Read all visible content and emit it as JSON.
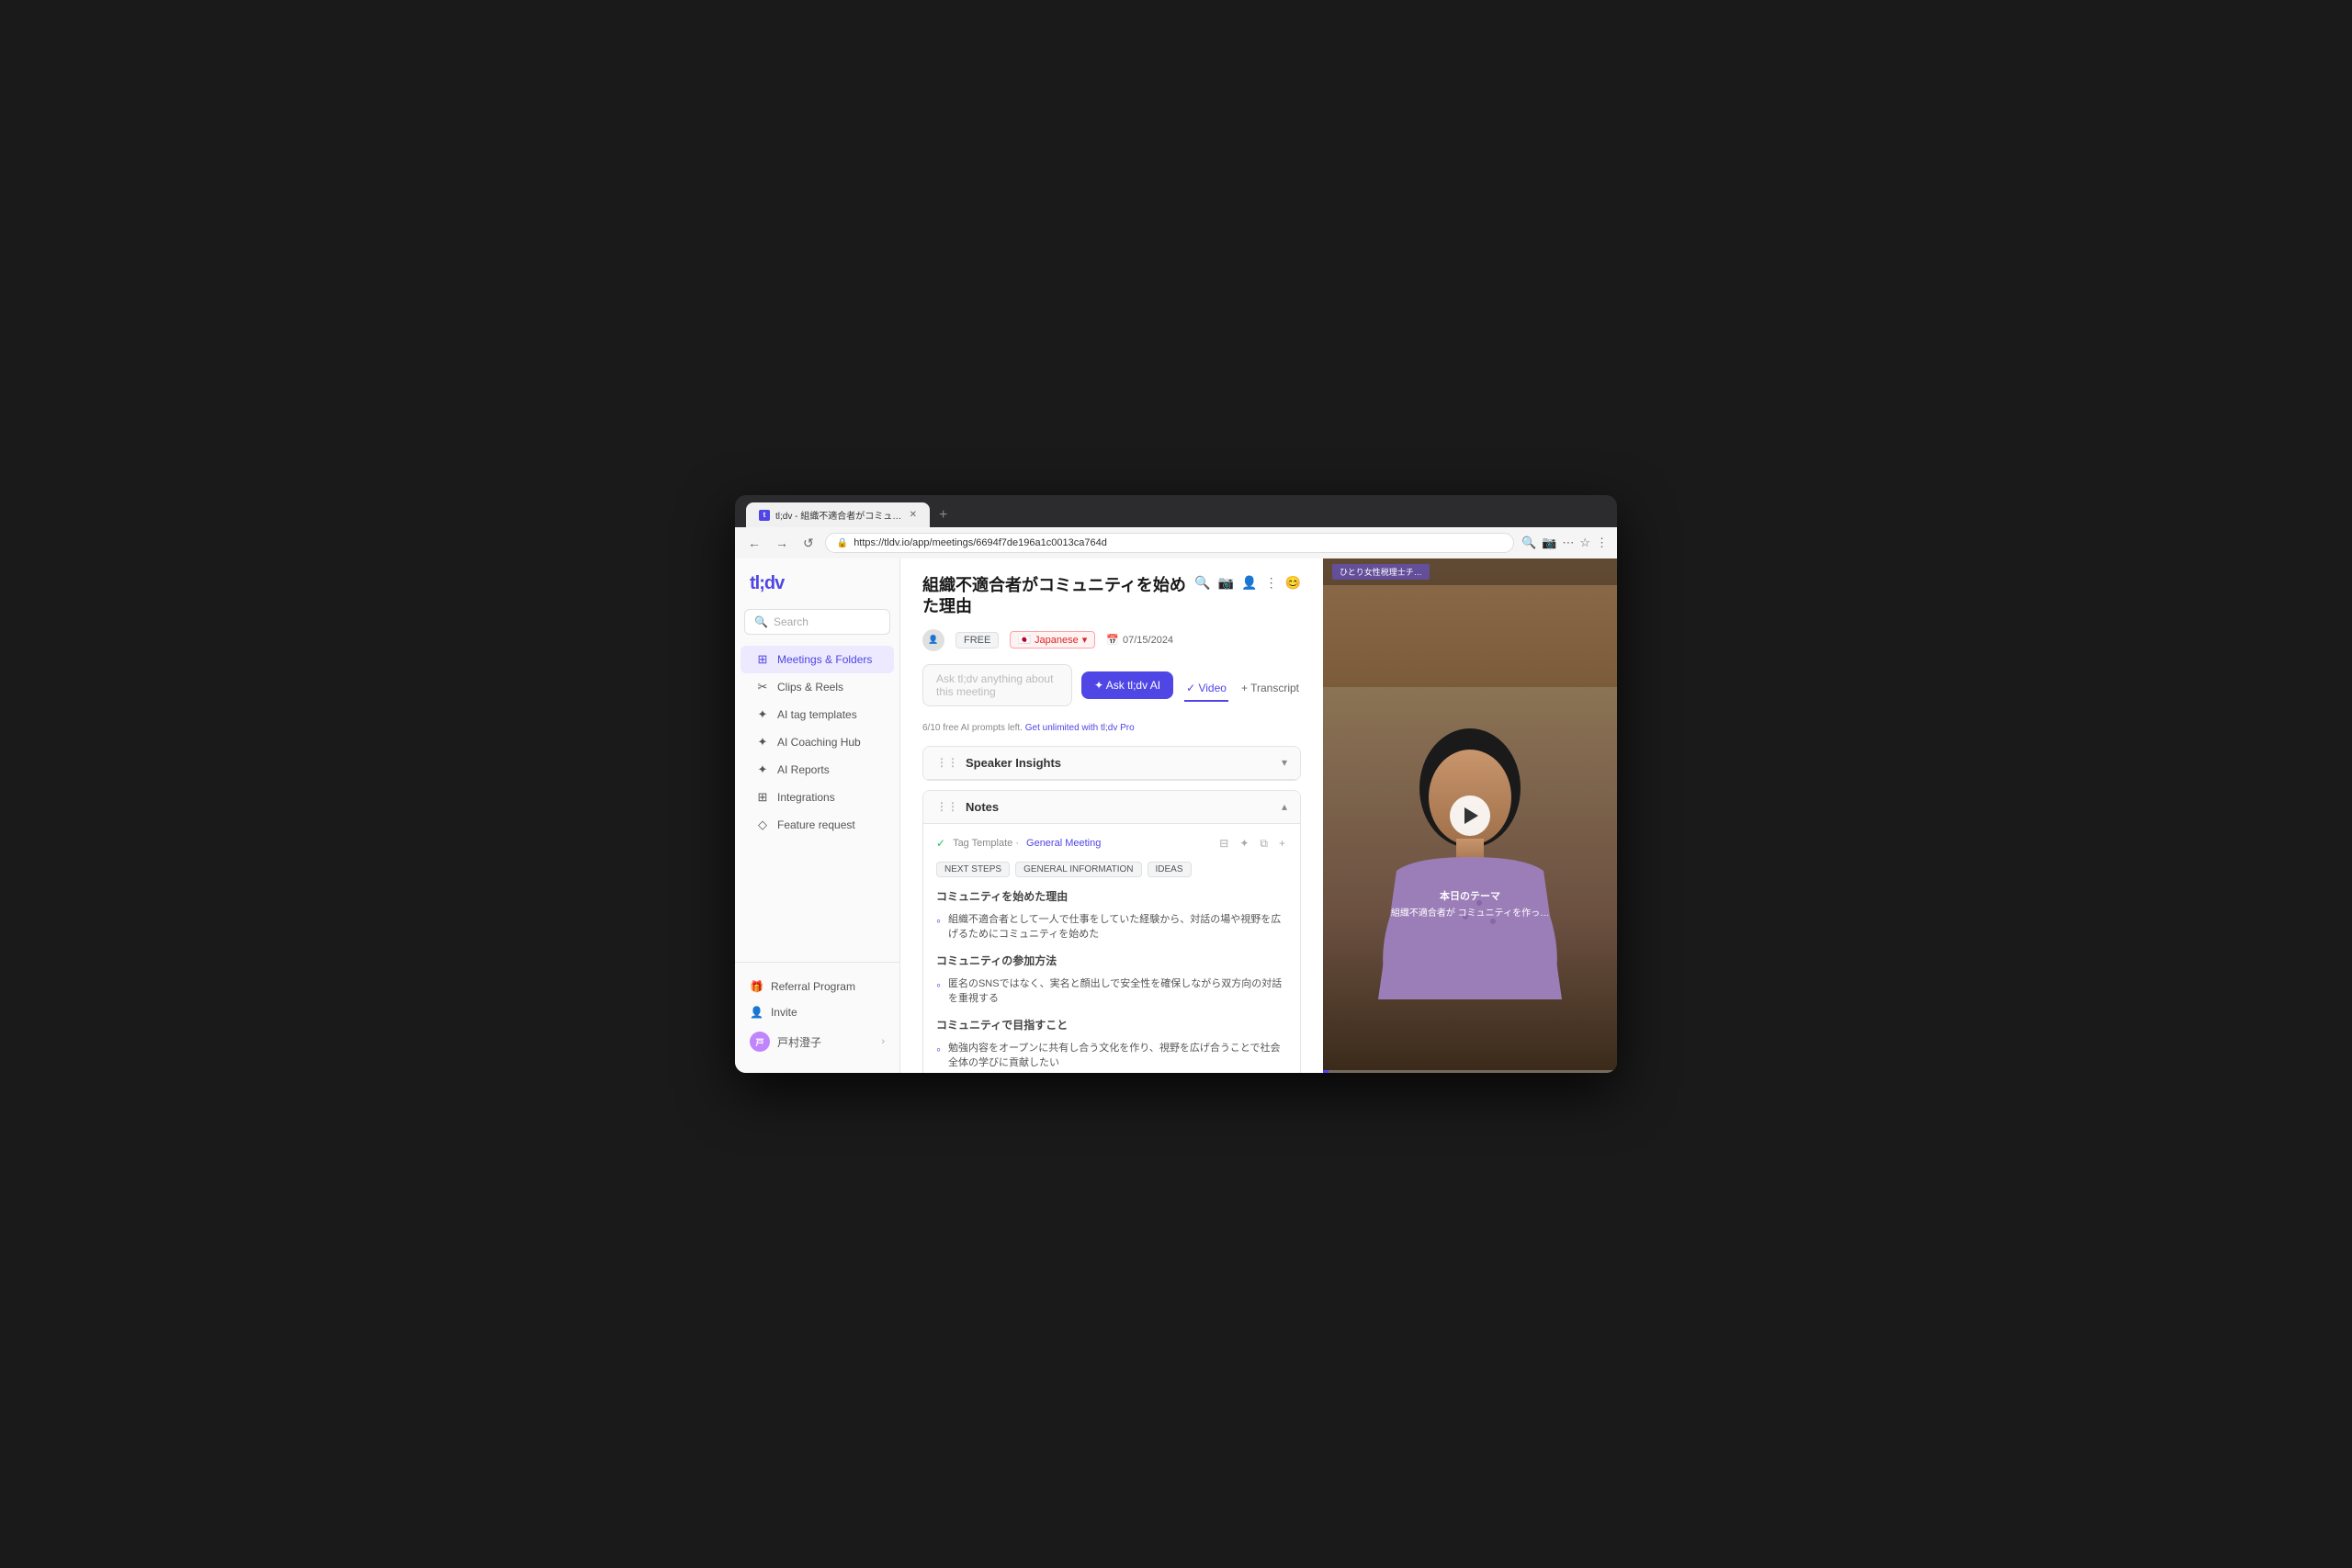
{
  "browser": {
    "tab_title": "tl;dv - 組織不適合者がコミュニ…",
    "tab_new_label": "+",
    "url": "https://tldv.io/app/meetings/6694f7de196a1c0013ca764d",
    "nav_back": "←",
    "nav_forward": "→",
    "nav_refresh": "↺"
  },
  "sidebar": {
    "logo": "tl;dv",
    "search_placeholder": "Search",
    "nav_items": [
      {
        "id": "meetings",
        "label": "Meetings & Folders",
        "icon": "⊞",
        "active": true
      },
      {
        "id": "clips",
        "label": "Clips & Reels",
        "icon": "✂"
      },
      {
        "id": "ai-tags",
        "label": "AI tag templates",
        "icon": "✦"
      },
      {
        "id": "coaching",
        "label": "AI Coaching Hub",
        "icon": "✦"
      },
      {
        "id": "reports",
        "label": "AI Reports",
        "icon": "✦"
      },
      {
        "id": "integrations",
        "label": "Integrations",
        "icon": "⊞"
      },
      {
        "id": "feature",
        "label": "Feature request",
        "icon": "◇"
      }
    ],
    "bottom_items": [
      {
        "id": "referral",
        "label": "Referral Program",
        "icon": "🎁"
      },
      {
        "id": "invite",
        "label": "Invite",
        "icon": "👤"
      }
    ],
    "user": {
      "name": "戸村澄子",
      "avatar_initials": "戸"
    }
  },
  "page": {
    "title": "組織不適合者がコミュニティを始めた理由",
    "badge_free": "FREE",
    "badge_language": "Japanese",
    "badge_date": "07/15/2024",
    "ai_input_placeholder": "Ask tl;dv anything about this meeting",
    "ask_btn_label": "✦ Ask tl;dv AI",
    "ai_hint": "6/10 free AI prompts left.",
    "ai_hint_link": "Get unlimited with tl;dv Pro",
    "view_tabs": [
      {
        "id": "video",
        "label": "✓ Video",
        "active": false
      },
      {
        "id": "transcript",
        "label": "+ Transcript",
        "active": false
      }
    ],
    "sections": [
      {
        "id": "speaker-insights",
        "title": "Speaker Insights",
        "collapsed": true
      },
      {
        "id": "notes",
        "title": "Notes",
        "collapsed": false,
        "tag_template_label": "Tag Template ·",
        "tag_template_name": "General Meeting",
        "chips": [
          "NEXT STEPS",
          "GENERAL INFORMATION",
          "IDEAS"
        ],
        "note_groups": [
          {
            "heading": "コミュニティを始めた理由",
            "items": [
              "組織不適合者として一人で仕事をしていた経験から、対話の場や視野を広げるためにコミュニティを始めた"
            ]
          },
          {
            "heading": "コミュニティの参加方法",
            "items": [
              "匿名のSNSではなく、実名と顔出しで安全性を確保しながら双方向の対話を重視する"
            ]
          },
          {
            "heading": "コミュニティで目指すこと",
            "items": [
              "勉強内容をオープンに共有し合う文化を作り、視野を広げ合うことで社会全体の学びに貢献したい"
            ]
          }
        ]
      }
    ]
  },
  "video": {
    "overlay_text": "ひとり女性税理士チ…",
    "subtitle_1": "本日のテーマ",
    "subtitle_2": "組織不適合者が コミュニティを作っ…",
    "progress": 2
  }
}
